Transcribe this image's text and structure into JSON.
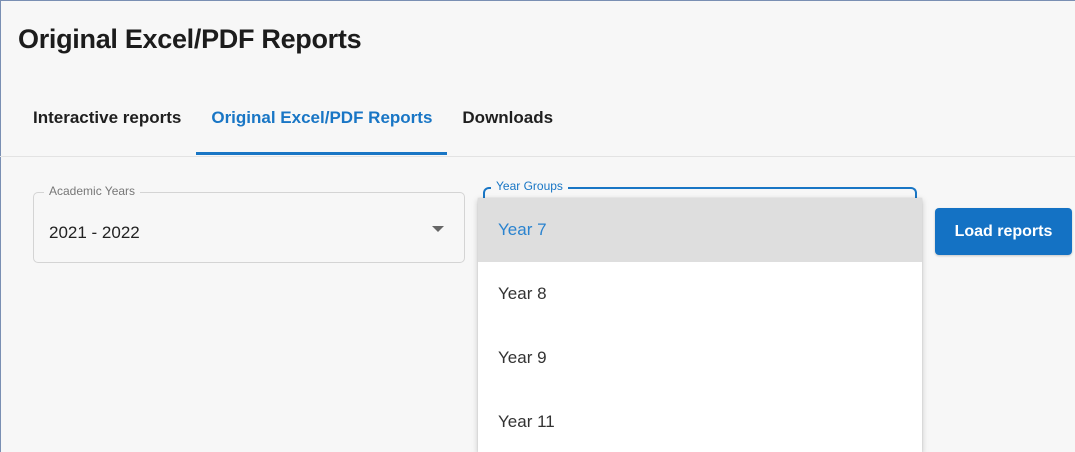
{
  "page": {
    "title": "Original Excel/PDF Reports"
  },
  "tabs": [
    {
      "label": "Interactive reports",
      "active": false
    },
    {
      "label": "Original Excel/PDF Reports",
      "active": true
    },
    {
      "label": "Downloads",
      "active": false
    }
  ],
  "academic_years": {
    "label": "Academic Years",
    "value": "2021 - 2022",
    "icon": "caret-down-icon"
  },
  "year_groups": {
    "label": "Year Groups",
    "expanded": true,
    "options": [
      {
        "label": "Year 7",
        "selected": true
      },
      {
        "label": "Year 8",
        "selected": false
      },
      {
        "label": "Year 9",
        "selected": false
      },
      {
        "label": "Year 11",
        "selected": false
      }
    ]
  },
  "load_button": {
    "label": "Load reports"
  },
  "colors": {
    "accent": "#1976c5",
    "button": "#1472c4",
    "selected_bg": "#dedede"
  }
}
